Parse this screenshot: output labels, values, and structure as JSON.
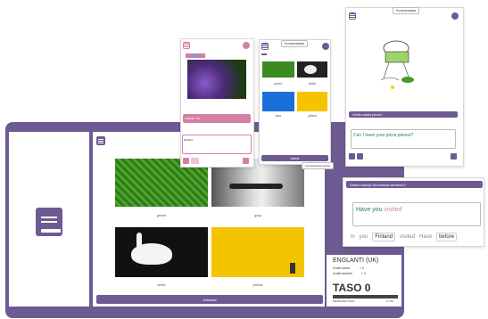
{
  "tablet": {
    "book_icon": "book-icon",
    "menu_icon": "menu-icon",
    "tiles": [
      {
        "label": "green"
      },
      {
        "label": "gray"
      },
      {
        "label": "white"
      },
      {
        "label": "yellow"
      }
    ],
    "submit_label": "tarkistaa"
  },
  "stats_panel": {
    "language": "ENGLANTI (UK)",
    "new_words_label": "Uudet sanat",
    "new_words_value": "= 0",
    "new_phrases_label": "Uudet lauseet",
    "new_phrases_value": "= 0",
    "level": "TASO 0",
    "next_level_label": "SEURAAVA TASO",
    "progress_text": "0 / 50",
    "progress_fraction": 0.0
  },
  "phone_crocus": {
    "bar_text": "crocus - be",
    "input_value": "crocu"
  },
  "phone_grid": {
    "badge": "Kuvasanastaa",
    "tiles": [
      "green",
      "white",
      "blue",
      "yellow"
    ],
    "submit_label": "valmis",
    "tooltip": "Kuvasanastaa tehdyt"
  },
  "phone_cartoon": {
    "badge": "Kuvasanastaa",
    "phrase_bar": "Voinko saada pizzan?",
    "answer_text": "Can I have your pizza please?"
  },
  "sentence_builder": {
    "question": "Oletko käynyt Suomessa aiemmin?",
    "answer_prefix": "Have you ",
    "answer_word": "visited",
    "words": [
      "in",
      "you",
      "Finland",
      "visited",
      "Have",
      "before"
    ],
    "selected_words": [
      "Finland",
      "before"
    ]
  },
  "colors": {
    "purple": "#6e5a93",
    "pink": "#d47fa6",
    "green_answer": "#2e7d4f"
  }
}
